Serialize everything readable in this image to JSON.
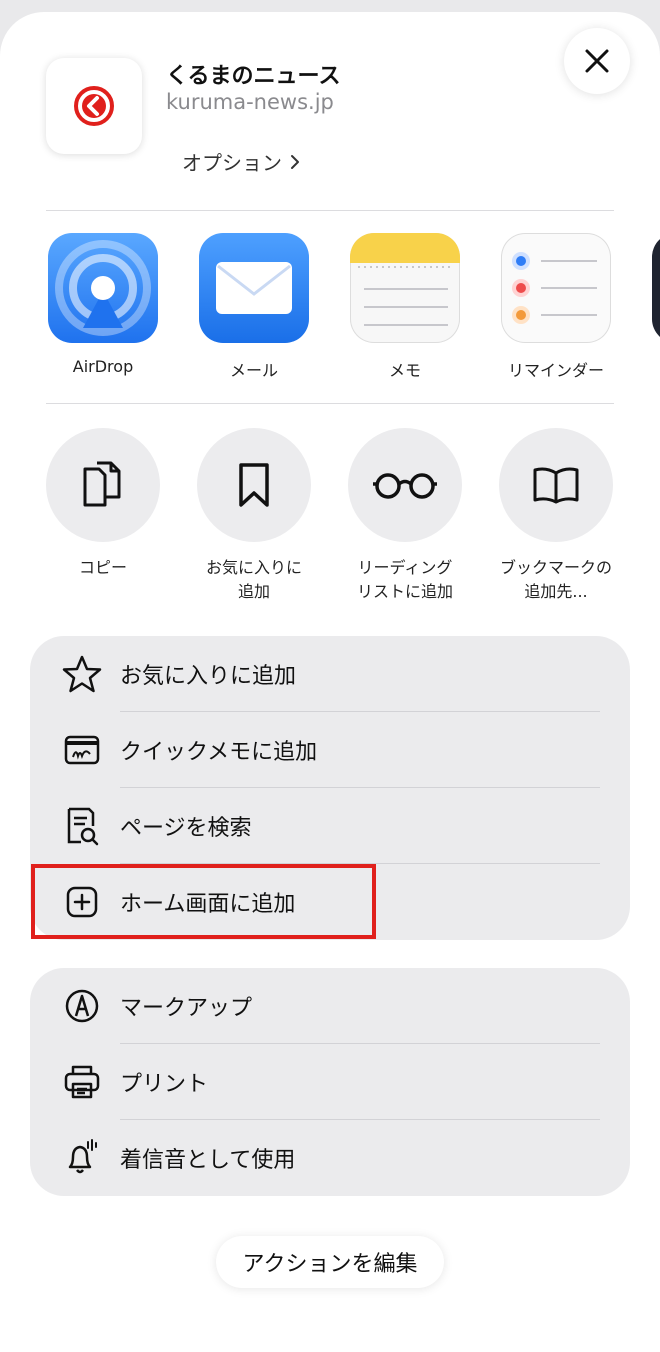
{
  "header": {
    "site_title": "くるまのニュース",
    "site_url": "kuruma-news.jp",
    "options_label": "オプション",
    "logo_color": "#e0201c"
  },
  "apps": [
    {
      "label": "AirDrop",
      "icon": "airdrop-icon"
    },
    {
      "label": "メール",
      "icon": "mail-icon"
    },
    {
      "label": "メモ",
      "icon": "notes-icon"
    },
    {
      "label": "リマインダー",
      "icon": "reminders-icon"
    }
  ],
  "actions": [
    {
      "label": "コピー",
      "icon": "copy-icon"
    },
    {
      "label": "お気に入りに\n追加",
      "icon": "bookmark-icon"
    },
    {
      "label": "リーディング\nリストに追加",
      "icon": "glasses-icon"
    },
    {
      "label": "ブックマークの\n追加先...",
      "icon": "book-icon"
    }
  ],
  "list1": [
    {
      "label": "お気に入りに追加",
      "icon": "star-icon"
    },
    {
      "label": "クイックメモに追加",
      "icon": "quick-note-icon"
    },
    {
      "label": "ページを検索",
      "icon": "find-on-page-icon"
    },
    {
      "label": "ホーム画面に追加",
      "icon": "add-square-icon"
    }
  ],
  "list2": [
    {
      "label": "マークアップ",
      "icon": "markup-icon"
    },
    {
      "label": "プリント",
      "icon": "printer-icon"
    },
    {
      "label": "着信音として使用",
      "icon": "bell-icon"
    }
  ],
  "footer": {
    "edit_actions_label": "アクションを編集"
  },
  "colors": {
    "highlight": "#e0201c",
    "card_bg": "#ebebed",
    "mail_blue": "#2f7df6"
  }
}
